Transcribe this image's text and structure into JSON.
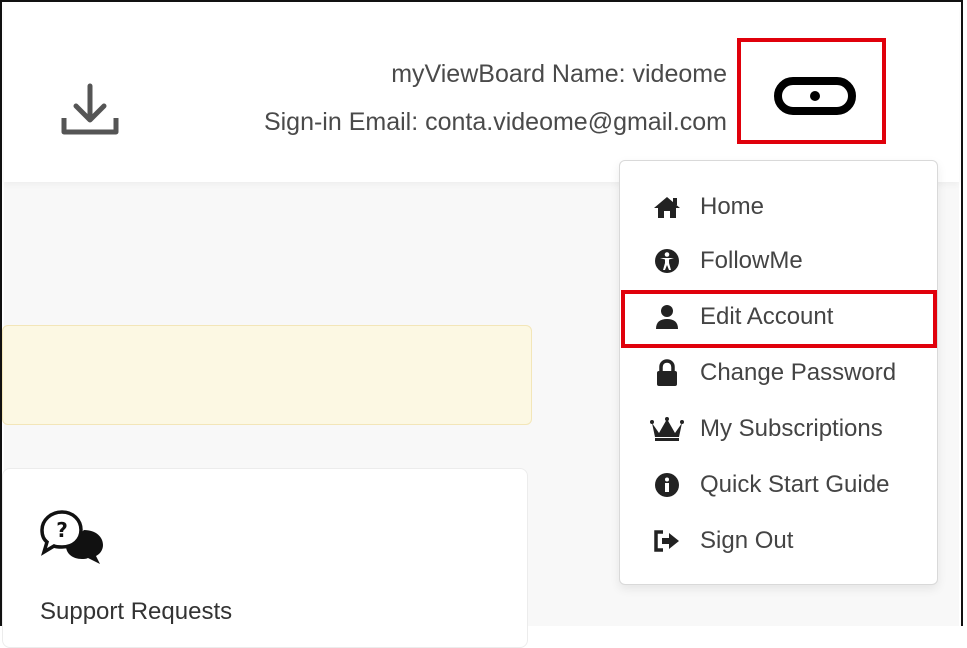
{
  "header": {
    "name_line": "myViewBoard Name: videome",
    "email_line": "Sign-in Email: conta.videome@gmail.com"
  },
  "menu": {
    "items": [
      {
        "label": "Home",
        "icon": "home-icon"
      },
      {
        "label": "FollowMe",
        "icon": "followme-icon"
      },
      {
        "label": "Edit Account",
        "icon": "user-icon"
      },
      {
        "label": "Change Password",
        "icon": "lock-icon"
      },
      {
        "label": "My Subscriptions",
        "icon": "crown-icon"
      },
      {
        "label": "Quick Start Guide",
        "icon": "info-icon"
      },
      {
        "label": "Sign Out",
        "icon": "sign-out-icon"
      }
    ]
  },
  "support": {
    "label": "Support Requests"
  },
  "colors": {
    "highlight": "#e0000b",
    "notice_bg": "#fcf8e3",
    "text": "#444444"
  }
}
